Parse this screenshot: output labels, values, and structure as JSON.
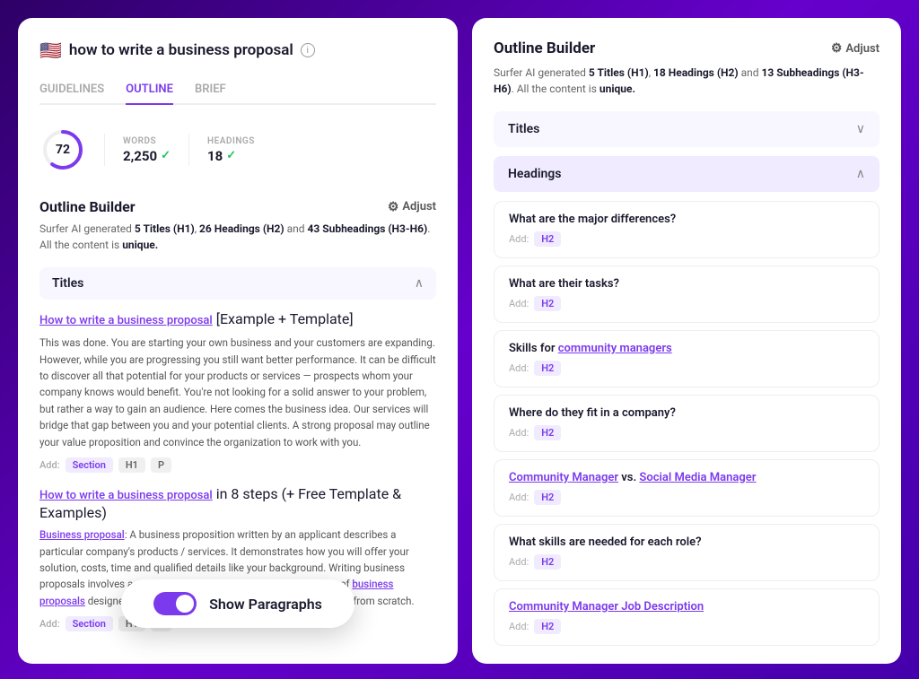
{
  "left": {
    "pageTitle": "how to write a business proposal",
    "tabs": [
      "GUIDELINES",
      "OUTLINE",
      "BRIEF"
    ],
    "activeTab": "OUTLINE",
    "metrics": {
      "score": 72,
      "words": {
        "label": "WORDS",
        "value": "2,250",
        "check": true
      },
      "headings": {
        "label": "HEADINGS",
        "value": "18",
        "check": true
      }
    },
    "outlineBuilder": {
      "title": "Outline Builder",
      "adjustLabel": "Adjust",
      "description": "Surfer AI generated 5 Titles (H1), 26 Headings (H2) and 43 Subheadings (H3-H6). All the content is unique.",
      "titlesSection": "Titles",
      "titles": [
        {
          "linkText": "How to write a business proposal",
          "restText": " [Example + Template]",
          "paragraph": "This was done. You are starting your own business and your customers are expanding. However, while you are progressing you still want better performance. It can be difficult to discover all that potential for your products or services — prospects whom your company knows would benefit. You're not looking for a solid answer to your problem, but rather a way to gain an audience. Here comes the business idea. Our services will bridge that gap between you and your potential clients. A strong proposal may outline your value proposition and convince the organization to work with you.",
          "addTags": [
            "Section",
            "H1",
            "P"
          ]
        },
        {
          "linkText": "How to write a business proposal",
          "restText": " in 8 steps (+ Free Template & Examples)",
          "paragraph": "Business proposal: A business proposition written by an applicant describes a particular company's products / services. It demonstrates how you will offer your solution, costs, time and qualified details like your background. Writing business proposals involves a number of research to cover the information of business proposals designed to new sales potential plug-in pro easy-to-follow from scratch.",
          "addTags": [
            "Section",
            "H1",
            "P"
          ]
        }
      ]
    },
    "toggleLabel": "Show Paragraphs"
  },
  "right": {
    "title": "Outline Builder",
    "adjustLabel": "Adjust",
    "description": "Surfer AI generated 5 Titles (H1), 18 Headings (H2) and 13 Subheadings (H3-H6). All the content is unique.",
    "titlesSection": "Titles",
    "headingsSection": "Headings",
    "headings": [
      {
        "title": "What are the major differences?",
        "addTag": "H2",
        "isLink": false
      },
      {
        "title": "What are their tasks?",
        "addTag": "H2",
        "isLink": false
      },
      {
        "title": "Skills for ",
        "linkText": "community managers",
        "afterLink": "",
        "addTag": "H2",
        "isLink": true
      },
      {
        "title": "Where do they fit in a company?",
        "addTag": "H2",
        "isLink": false
      },
      {
        "titleParts": [
          {
            "text": "Community Manager",
            "link": true
          },
          {
            "text": " vs. ",
            "link": false
          },
          {
            "text": "Social Media Manager",
            "link": true
          }
        ],
        "addTag": "H2",
        "isLink": true,
        "isMultiLink": true
      },
      {
        "title": "What skills are needed for each role?",
        "addTag": "H2",
        "isLink": false
      },
      {
        "title": "Community Manager Job Description",
        "addTag": "H2",
        "isLink": true,
        "isSingleFullLink": true
      }
    ]
  }
}
